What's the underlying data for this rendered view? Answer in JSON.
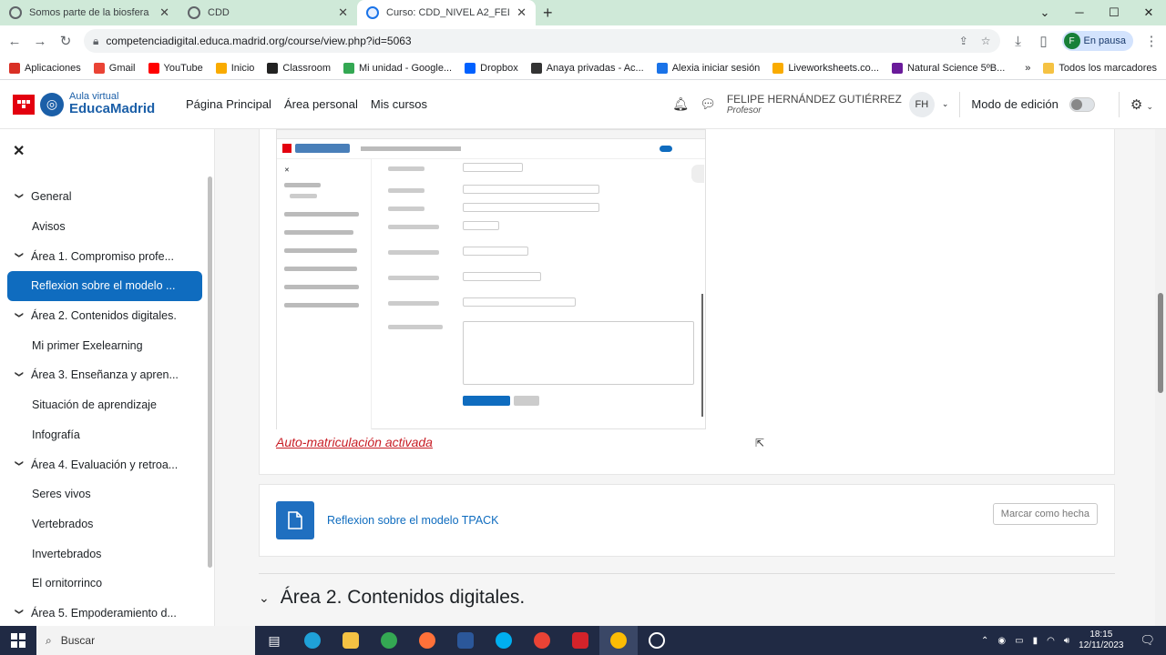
{
  "browser": {
    "tabs": [
      {
        "title": "Somos parte de la biosfera",
        "active": false
      },
      {
        "title": "CDD",
        "active": false
      },
      {
        "title": "Curso: CDD_NIVEL A2_FELIPE HE",
        "active": true
      }
    ],
    "new_tab": "+",
    "url": "competenciadigital.educa.madrid.org/course/view.php?id=5063",
    "profile_initial": "F",
    "profile_label": "En pausa",
    "bookmarks": [
      {
        "label": "Aplicaciones",
        "color": "#d93025"
      },
      {
        "label": "Gmail",
        "color": "#ea4335"
      },
      {
        "label": "YouTube",
        "color": "#ff0000"
      },
      {
        "label": "Inicio",
        "color": "#f9ab00"
      },
      {
        "label": "Classroom",
        "color": "#222222"
      },
      {
        "label": "Mi unidad - Google...",
        "color": "#34a853"
      },
      {
        "label": "Dropbox",
        "color": "#0061ff"
      },
      {
        "label": "Anaya privadas - Ac...",
        "color": "#333333"
      },
      {
        "label": "Alexia iniciar sesión",
        "color": "#1a73e8"
      },
      {
        "label": "Liveworksheets.co...",
        "color": "#f9ab00"
      },
      {
        "label": "Natural Science 5ºB...",
        "color": "#6a1b9a"
      }
    ],
    "bookmarks_more": "»",
    "all_bookmarks": "Todos los marcadores"
  },
  "site": {
    "logo_small": "Aula virtual",
    "logo_big": "EducaMadrid",
    "menu": [
      "Página Principal",
      "Área personal",
      "Mis cursos"
    ],
    "user_name": "FELIPE HERNÁNDEZ GUTIÉRREZ",
    "user_role": "Profesor",
    "user_initials": "FH",
    "edit_mode_label": "Modo de edición",
    "edit_mode_on": false
  },
  "sidebar": {
    "items": [
      {
        "label": "General",
        "type": "section"
      },
      {
        "label": "Avisos",
        "type": "activity"
      },
      {
        "label": "Área 1. Compromiso profe...",
        "type": "section"
      },
      {
        "label": "Reflexion sobre el modelo ...",
        "type": "activity",
        "selected": true
      },
      {
        "label": "Área 2. Contenidos digitales.",
        "type": "section"
      },
      {
        "label": "Mi primer Exelearning",
        "type": "activity"
      },
      {
        "label": "Área 3. Enseñanza y apren...",
        "type": "section"
      },
      {
        "label": "Situación de aprendizaje",
        "type": "activity"
      },
      {
        "label": "Infografía",
        "type": "activity"
      },
      {
        "label": "Área 4. Evaluación y retroa...",
        "type": "section"
      },
      {
        "label": "Seres vivos",
        "type": "activity"
      },
      {
        "label": "Vertebrados",
        "type": "activity"
      },
      {
        "label": "Invertebrados",
        "type": "activity"
      },
      {
        "label": "El ornitorrinco",
        "type": "activity"
      },
      {
        "label": "Área 5. Empoderamiento d...",
        "type": "section"
      }
    ]
  },
  "main": {
    "auto_link": "Auto-matriculación activada",
    "activity_title": "Reflexion sobre el modelo TPACK",
    "mark_done": "Marcar como hecha",
    "next_section": "Área 2. Contenidos digitales."
  },
  "taskbar": {
    "search": "Buscar",
    "time": "18:15",
    "date": "12/11/2023"
  }
}
